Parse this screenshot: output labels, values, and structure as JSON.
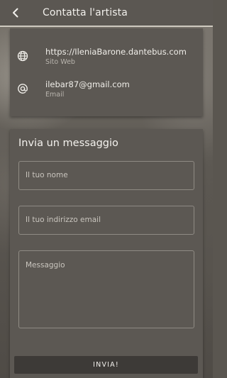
{
  "header": {
    "title": "Contatta l'artista"
  },
  "contact": {
    "website": {
      "value": "https://IleniaBarone.dantebus.com",
      "label": "Sito Web",
      "icon": "globe-icon"
    },
    "email": {
      "value": "ilebar87@gmail.com",
      "label": "Email",
      "icon": "at-icon"
    }
  },
  "form": {
    "title": "Invia un messaggio",
    "name_placeholder": "Il tuo nome",
    "email_placeholder": "Il tuo indirizzo email",
    "message_placeholder": "Messaggio",
    "submit_label": "INVIA!"
  }
}
